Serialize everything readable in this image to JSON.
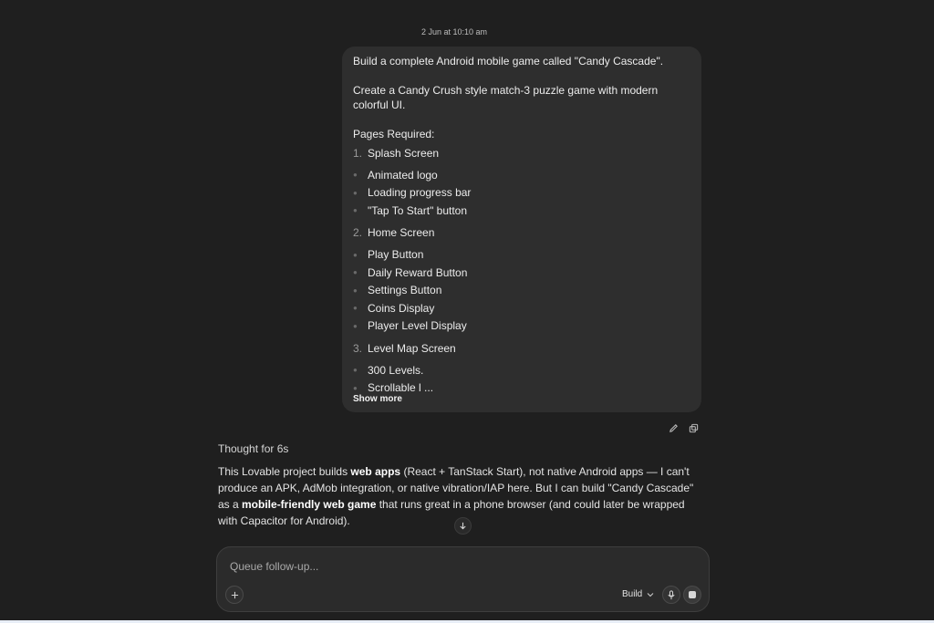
{
  "timestamp": "2 Jun at 10:10 am",
  "user_message": {
    "p1": "Build a complete Android mobile game called \"Candy Cascade\".",
    "p2": "Create a Candy Crush style match-3 puzzle game with modern colorful UI.",
    "p3": "Pages Required:",
    "sections": [
      {
        "num": "1.",
        "title": "Splash Screen",
        "items": [
          "Animated logo",
          "Loading progress bar",
          "\"Tap To Start\" button"
        ]
      },
      {
        "num": "2.",
        "title": "Home Screen",
        "items": [
          "Play Button",
          "Daily Reward Button",
          "Settings Button",
          "Coins Display",
          "Player Level Display"
        ]
      },
      {
        "num": "3.",
        "title": "Level Map Screen",
        "items": [
          "300 Levels.",
          "Scrollable l ..."
        ]
      }
    ],
    "show_more": "Show more"
  },
  "message_actions": {
    "edit_icon": "pencil-icon",
    "copy_icon": "copy-icon"
  },
  "thought": "Thought for 6s",
  "reply": {
    "t1": "This Lovable project builds ",
    "b1": "web apps",
    "t2": " (React + TanStack Start), not native Android apps — I can't produce an APK, AdMob integration, or native vibration/IAP here. But I can build \"Candy Cascade\" as a ",
    "b2": "mobile-friendly web game",
    "t3": " that runs great in a phone browser (and could later be wrapped with Capacitor for Android)."
  },
  "composer": {
    "placeholder": "Queue follow-up...",
    "mode": "Build"
  },
  "colors": {
    "background": "#1f1f1f",
    "bubble": "#2e2e2e",
    "composer": "#2b2b2b"
  }
}
